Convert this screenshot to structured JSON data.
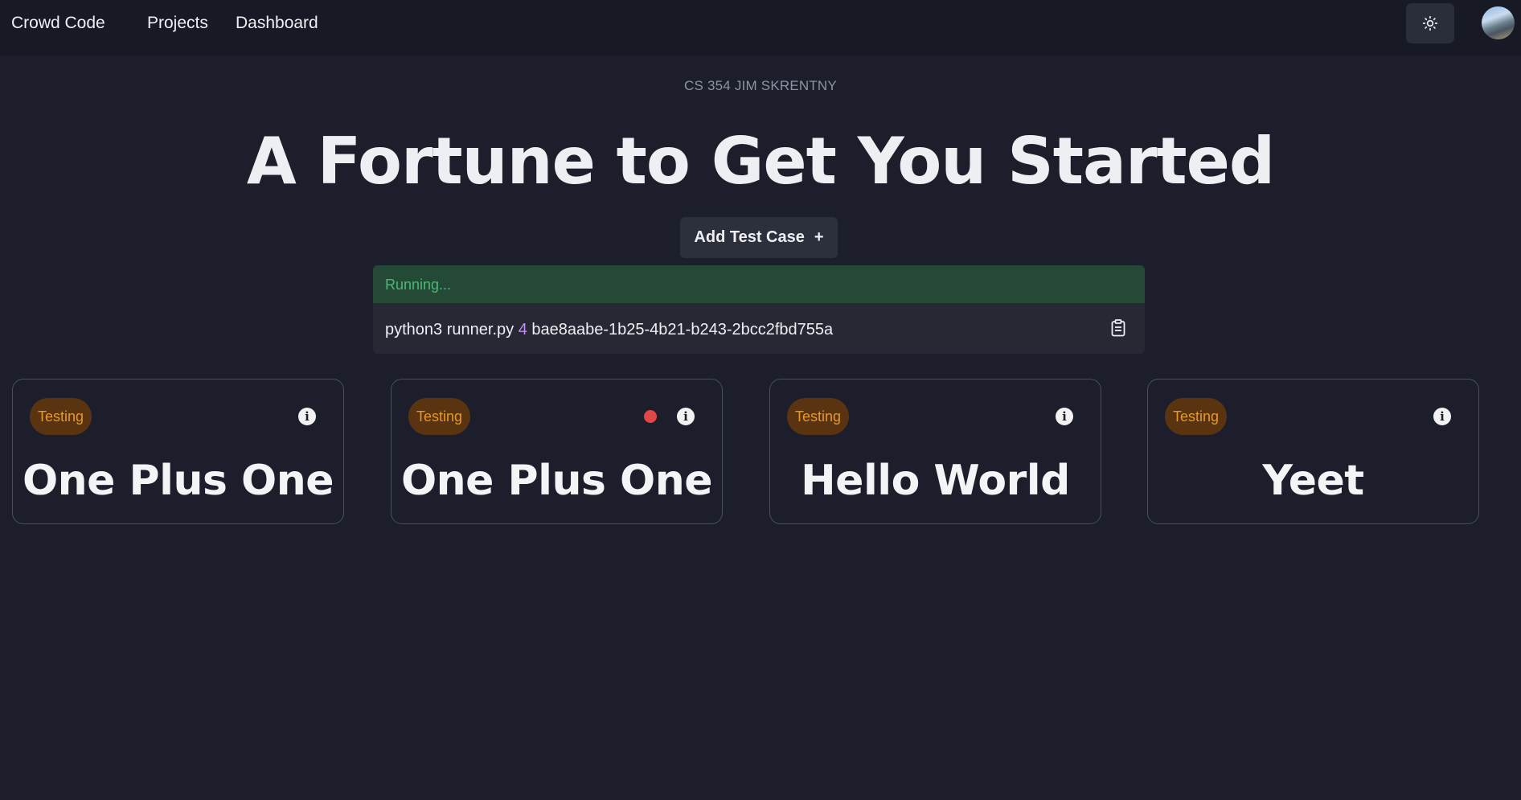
{
  "nav": {
    "brand": "Crowd Code",
    "links": [
      "Projects",
      "Dashboard"
    ]
  },
  "header": {
    "course": "CS 354  JIM SKRENTNY",
    "title": "A Fortune to Get You Started"
  },
  "actions": {
    "add_test_case": "Add Test Case",
    "add_icon": "+"
  },
  "run": {
    "status": "Running...",
    "command_prefix": "python3 runner.py",
    "command_arg": "4",
    "command_id": "bae8aabe-1b25-4b21-b243-2bcc2fbd755a"
  },
  "cards": [
    {
      "badge": "Testing",
      "title": "One Plus One",
      "alert": false
    },
    {
      "badge": "Testing",
      "title": "One Plus One",
      "alert": true
    },
    {
      "badge": "Testing",
      "title": "Hello World",
      "alert": false
    },
    {
      "badge": "Testing",
      "title": "Yeet",
      "alert": false
    }
  ],
  "icons": {
    "theme": "sun-icon",
    "info": "info-icon",
    "clipboard": "clipboard-icon"
  },
  "colors": {
    "background": "#1c1f2b",
    "badge_bg": "#5a3410",
    "badge_text": "#e4982e",
    "status_bg": "#244a37",
    "status_text": "#4cb874",
    "alert_dot": "#e24646"
  }
}
